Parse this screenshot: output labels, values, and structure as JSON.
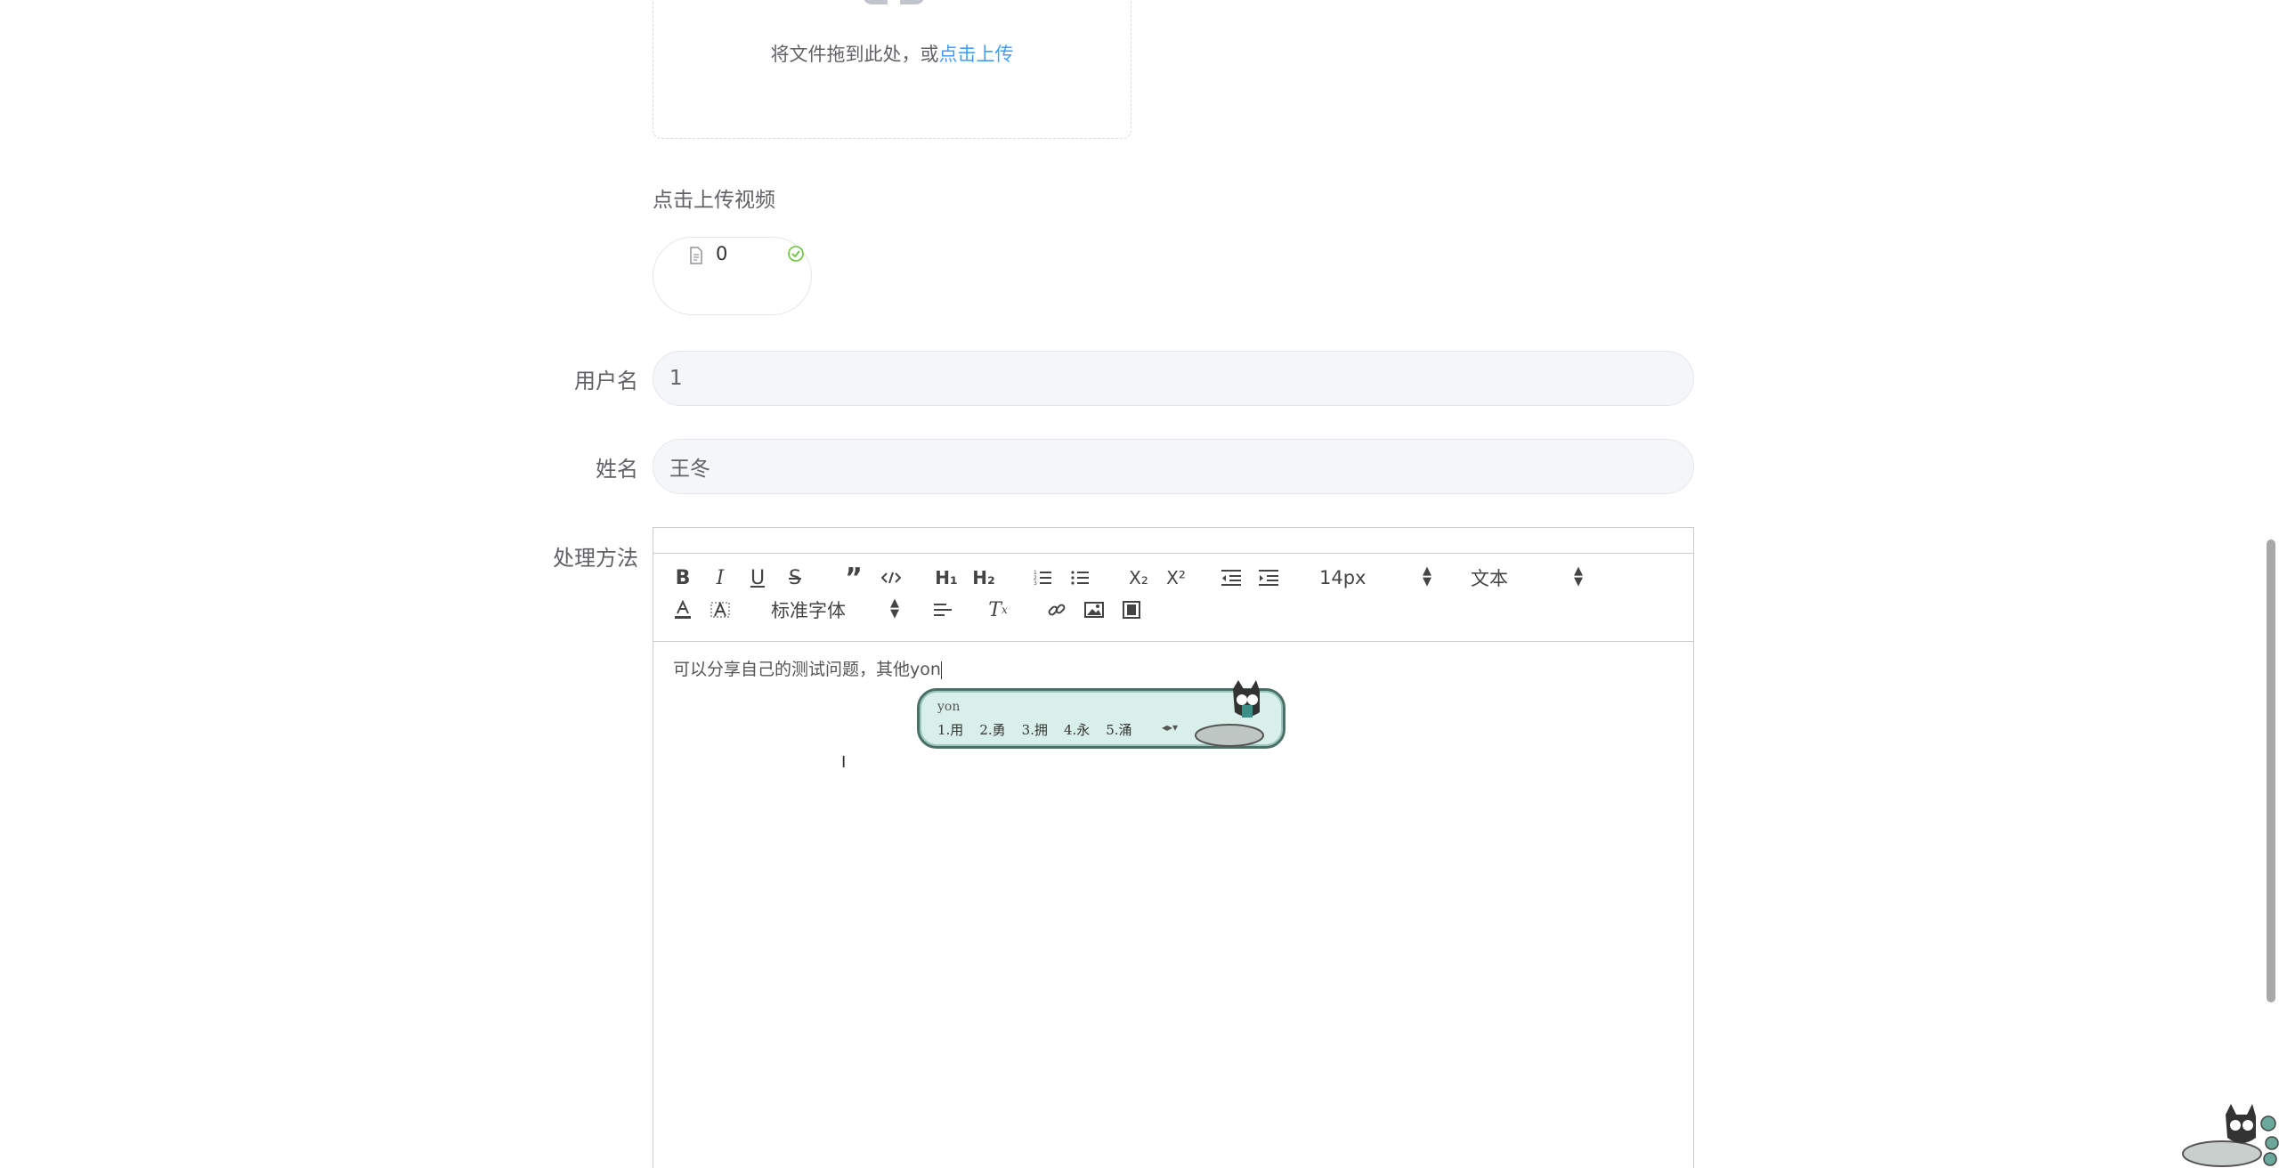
{
  "upload": {
    "hint_prefix": "将文件拖到此处，或",
    "hint_link": "点击上传"
  },
  "video": {
    "title": "点击上传视频",
    "file_name": "0"
  },
  "form": {
    "username_label": "用户名",
    "username_value": "1",
    "name_label": "姓名",
    "name_value": "王冬",
    "method_label": "处理方法"
  },
  "editor": {
    "font_size": "14px",
    "header_select": "文本",
    "font_family": "标准字体",
    "content": "可以分享自己的测试问题，其他yon"
  },
  "ime": {
    "composition": "yon",
    "candidates": [
      "1.用",
      "2.勇",
      "3.拥",
      "4.永",
      "5.涌"
    ]
  },
  "colors": {
    "link": "#409eff",
    "success": "#67c23a",
    "input_bg": "#f5f6f8"
  }
}
